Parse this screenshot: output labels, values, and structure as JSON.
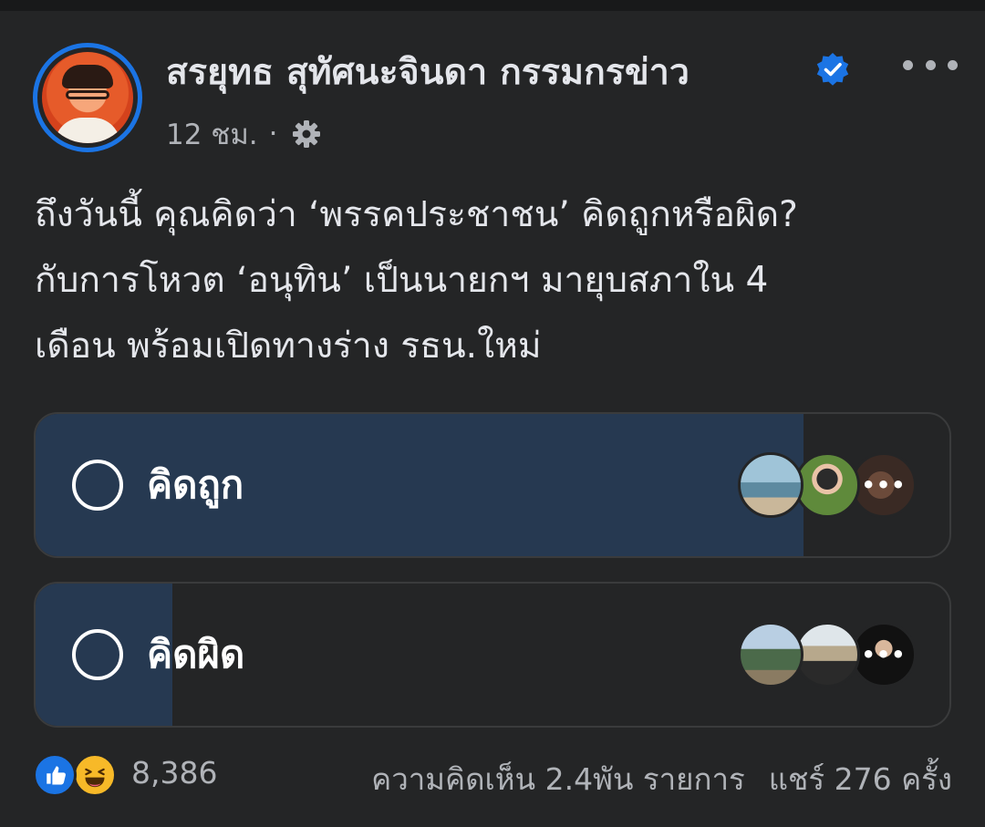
{
  "post": {
    "author": "สรยุทธ สุทัศนะจินดา กรรมกรข่าว",
    "time": "12 ชม.",
    "separator": "·",
    "icons": {
      "verified": "verified-badge-icon",
      "privacy": "gear-icon",
      "more": "more-options-icon"
    },
    "text_lines": [
      "ถึงวันนี้ คุณคิดว่า ‘พรรคประชาชน’ คิดถูกหรือผิด?",
      "กับการโหวต ‘อนุทิน’ เป็นนายกฯ มายุบสภาใน 4",
      "เดือน พร้อมเปิดทางร่าง รธน.ใหม่"
    ]
  },
  "poll": {
    "options": [
      {
        "label": "คิดถูก",
        "fill_fraction": 0.84,
        "more_voters": "•••"
      },
      {
        "label": "คิดผิด",
        "fill_fraction": 0.15,
        "more_voters": "•••"
      }
    ]
  },
  "footer": {
    "reactions": [
      "like-icon",
      "haha-icon"
    ],
    "reaction_count": "8,386",
    "comments": "ความคิดเห็น 2.4พัน รายการ",
    "shares": "แชร์ 276 ครั้ง"
  },
  "colors": {
    "background": "#242526",
    "accent": "#1b74e4",
    "poll_fill": "#263951",
    "secondary_text": "#b0b3b8"
  }
}
